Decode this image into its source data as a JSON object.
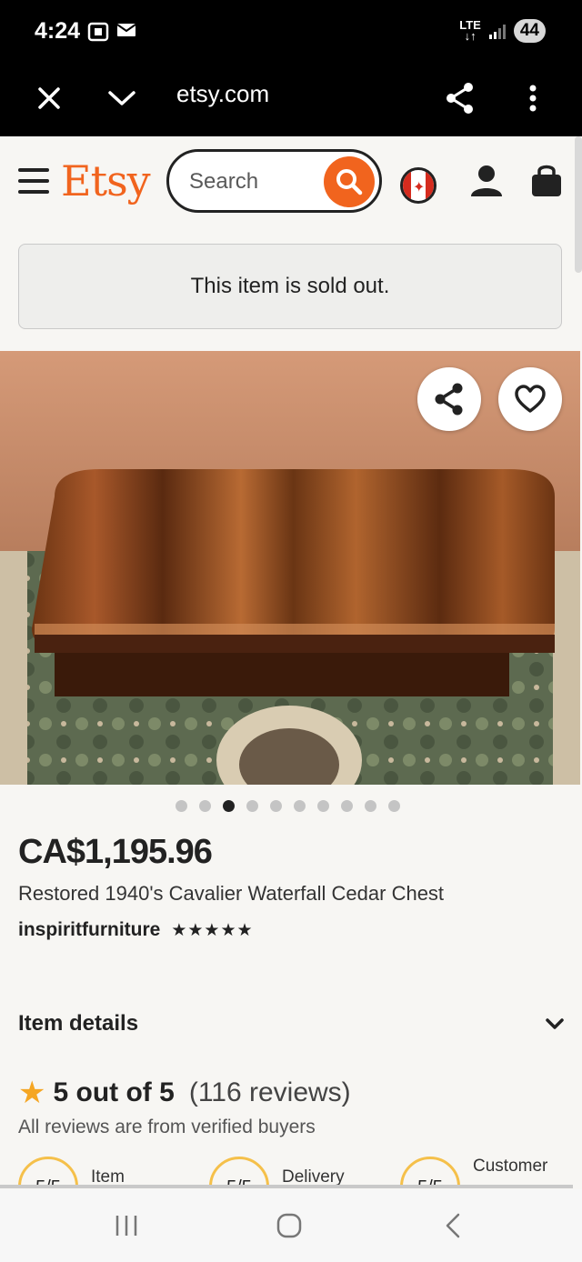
{
  "status_bar": {
    "time": "4:24",
    "network": "LTE",
    "battery": "44"
  },
  "browser": {
    "url": "etsy.com"
  },
  "header": {
    "logo": "Etsy",
    "search_placeholder": "Search"
  },
  "banner": {
    "text": "This item is sold out."
  },
  "gallery": {
    "image_count": 10,
    "active_index": 2
  },
  "listing": {
    "price": "CA$1,195.96",
    "title": "Restored 1940's Cavalier Waterfall Cedar Chest",
    "seller": "inspiritfurniture",
    "seller_stars": "★★★★★",
    "seller_rating": 5
  },
  "item_details": {
    "label": "Item details"
  },
  "reviews": {
    "rating_text": "5 out of 5",
    "count_text": "(116 reviews)",
    "verified_text": "All reviews are from verified buyers",
    "subratings": [
      {
        "score": "5/5",
        "label": "Item"
      },
      {
        "score": "5/5",
        "label": "Delivery"
      },
      {
        "score": "5/5",
        "label": "Customer"
      }
    ]
  },
  "colors": {
    "brand": "#f1641e",
    "star": "#f5a623",
    "subrating_ring": "#f5c04a"
  }
}
